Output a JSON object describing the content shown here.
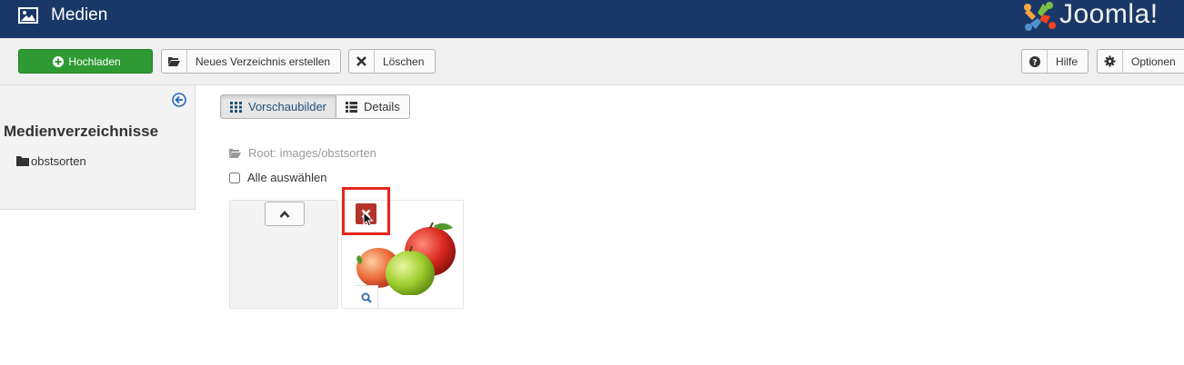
{
  "header": {
    "title": "Medien",
    "title_icon": "image-icon",
    "brand_text": "Joomla!",
    "brand_icon": "joomla-logo"
  },
  "toolbar": {
    "upload_label": "Hochladen",
    "new_folder_label": "Neues Verzeichnis erstellen",
    "delete_label": "Löschen",
    "help_label": "Hilfe",
    "options_label": "Optionen"
  },
  "sidebar": {
    "heading": "Medienverzeichnisse",
    "folders": [
      {
        "label": "obstsorten"
      }
    ]
  },
  "view": {
    "thumbnails_label": "Vorschaubilder",
    "details_label": "Details",
    "active": "thumbnails"
  },
  "breadcrumb": {
    "path": "Root: images/obstsorten"
  },
  "select_all": {
    "label": "Alle auswählen",
    "checked": false
  },
  "items": [
    {
      "type": "folder-up",
      "icon": "chevron-up-icon"
    },
    {
      "type": "image",
      "icon": "apples-thumbnail"
    }
  ],
  "colors": {
    "header_bg": "#1a3867",
    "success": "#2f9a33",
    "danger": "#b4332a",
    "highlight": "#e3261d",
    "active_text": "#1f4f7c"
  }
}
